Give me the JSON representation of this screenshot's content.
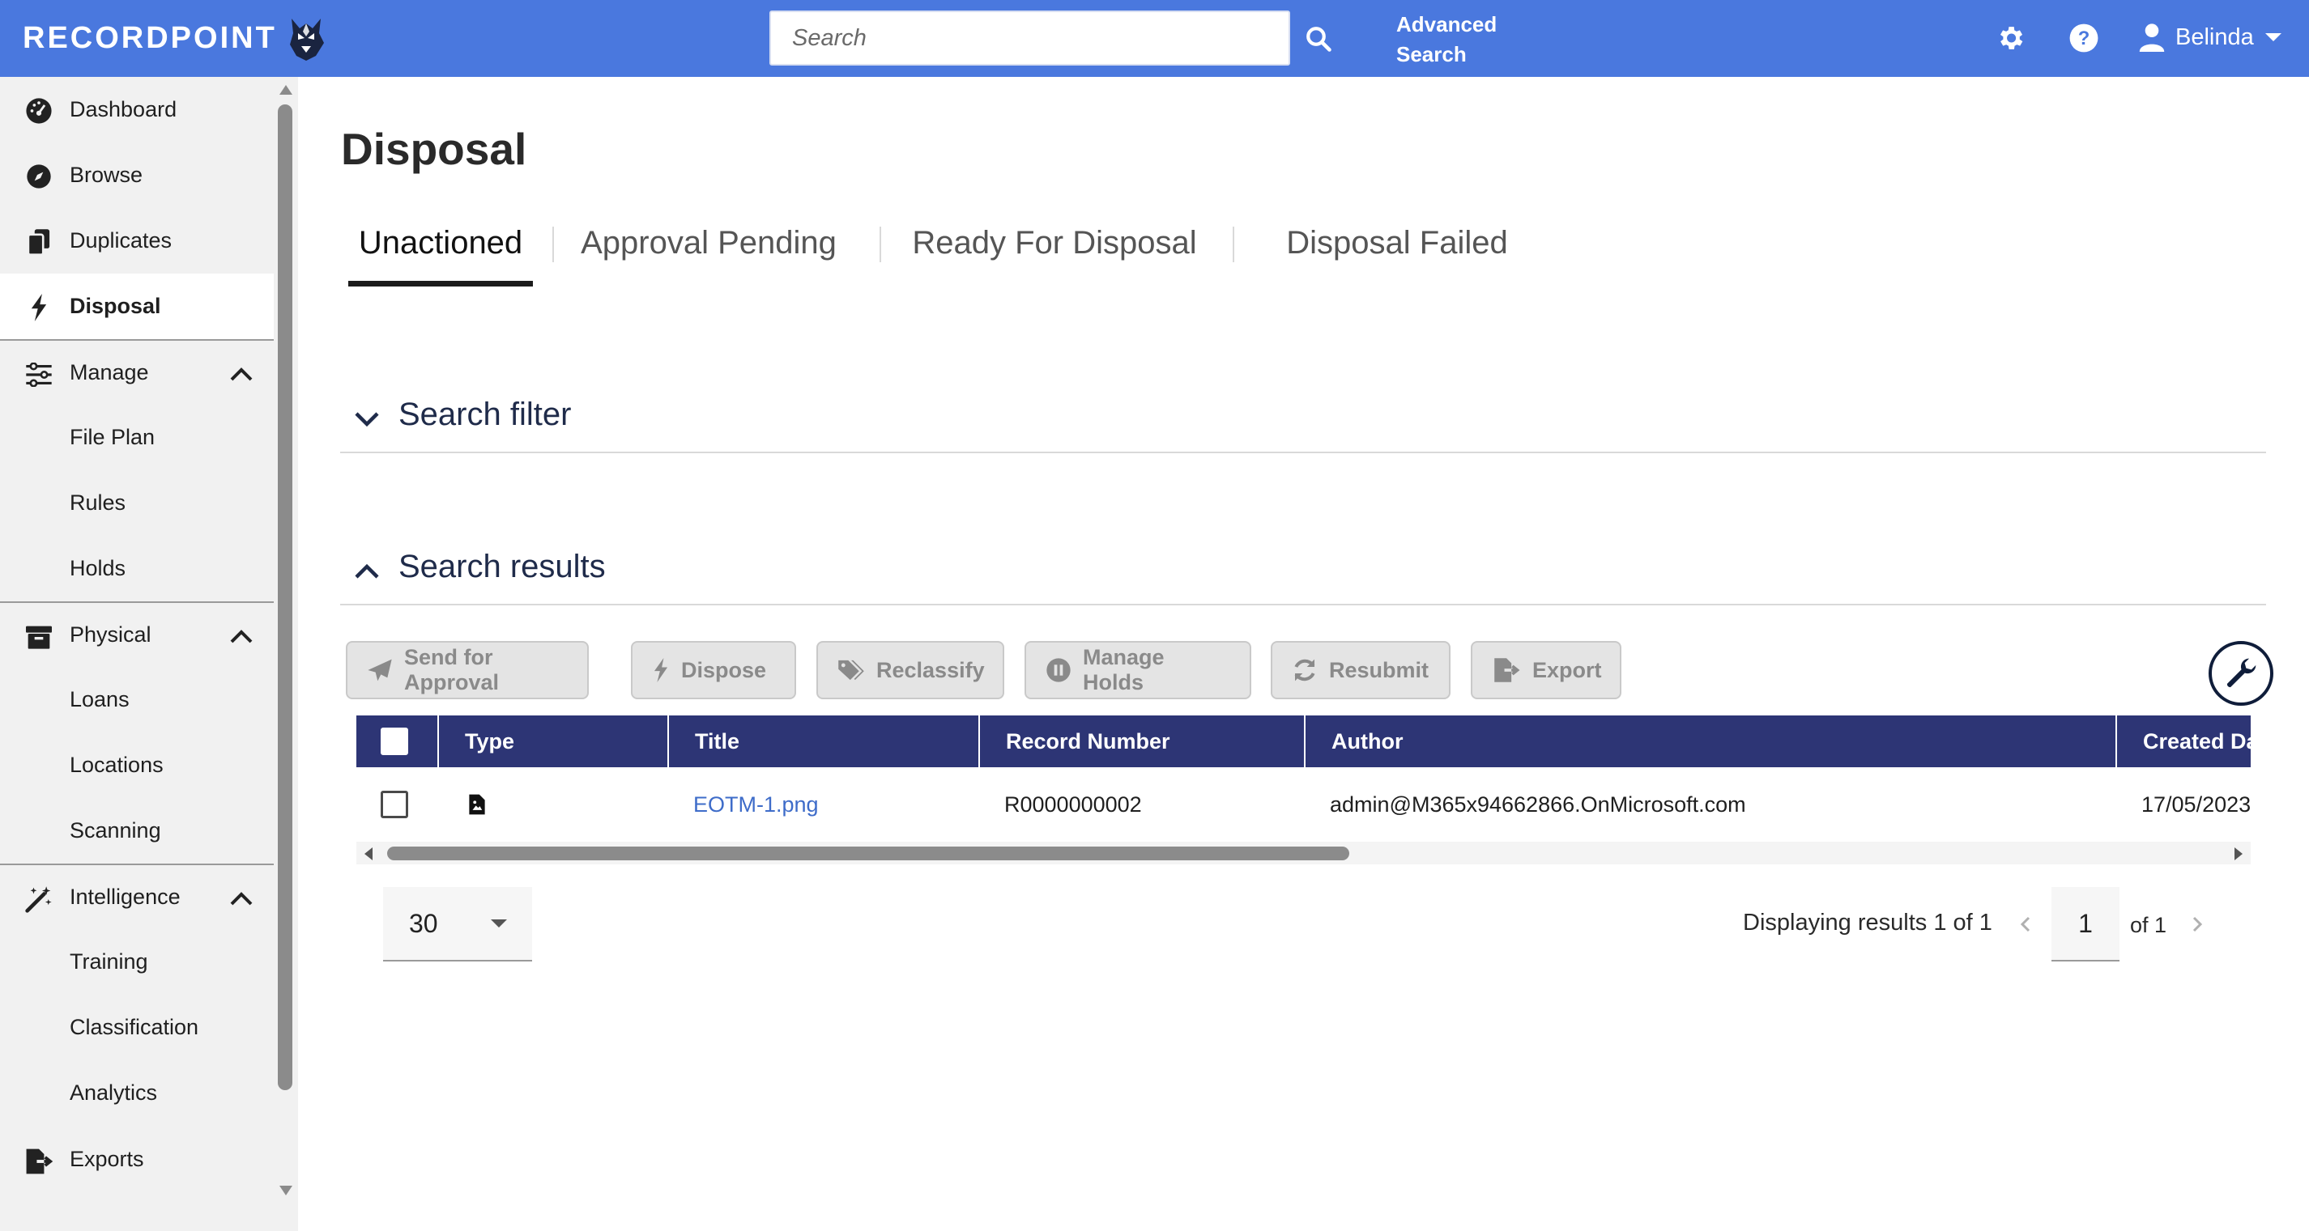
{
  "app": {
    "logo_text": "RECORDPOINT"
  },
  "header": {
    "search_placeholder": "Search",
    "advanced_search_line1": "Advanced",
    "advanced_search_line2": "Search",
    "user_name": "Belinda",
    "accent_color": "#4a78de"
  },
  "sidebar": {
    "items": [
      {
        "label": "Dashboard",
        "icon": "dashboard-icon"
      },
      {
        "label": "Browse",
        "icon": "compass-icon"
      },
      {
        "label": "Duplicates",
        "icon": "duplicates-icon"
      },
      {
        "label": "Disposal",
        "icon": "lightning-icon",
        "active": true
      },
      {
        "label": "Manage",
        "icon": "sliders-icon",
        "expanded": true
      },
      {
        "label": "File Plan"
      },
      {
        "label": "Rules"
      },
      {
        "label": "Holds"
      },
      {
        "label": "Physical",
        "icon": "archive-box-icon",
        "expanded": true
      },
      {
        "label": "Loans"
      },
      {
        "label": "Locations"
      },
      {
        "label": "Scanning"
      },
      {
        "label": "Intelligence",
        "icon": "magic-wand-icon",
        "expanded": true
      },
      {
        "label": "Training"
      },
      {
        "label": "Classification"
      },
      {
        "label": "Analytics"
      },
      {
        "label": "Exports",
        "icon": "file-export-icon"
      }
    ]
  },
  "main": {
    "title": "Disposal",
    "tabs": [
      {
        "label": "Unactioned",
        "active": true
      },
      {
        "label": "Approval Pending"
      },
      {
        "label": "Ready For Disposal"
      },
      {
        "label": "Disposal Failed"
      }
    ],
    "search_filter_label": "Search filter",
    "search_results_label": "Search results",
    "toolbar": {
      "send_for_approval": "Send for Approval",
      "dispose": "Dispose",
      "reclassify": "Reclassify",
      "manage_holds": "Manage Holds",
      "resubmit": "Resubmit",
      "export": "Export"
    },
    "table": {
      "header_color": "#2d3575",
      "columns": [
        "Type",
        "Title",
        "Record Number",
        "Author",
        "Created Da"
      ],
      "rows": [
        {
          "type_icon": "image-file-icon",
          "title": "EOTM-1.png",
          "record_number": "R0000000002",
          "author": "admin@M365x94662866.OnMicrosoft.com",
          "created": "17/05/2023"
        }
      ]
    },
    "pagination": {
      "page_size": "30",
      "results_text": "Displaying results 1 of 1",
      "current_page": "1",
      "of_text": "of 1"
    }
  }
}
